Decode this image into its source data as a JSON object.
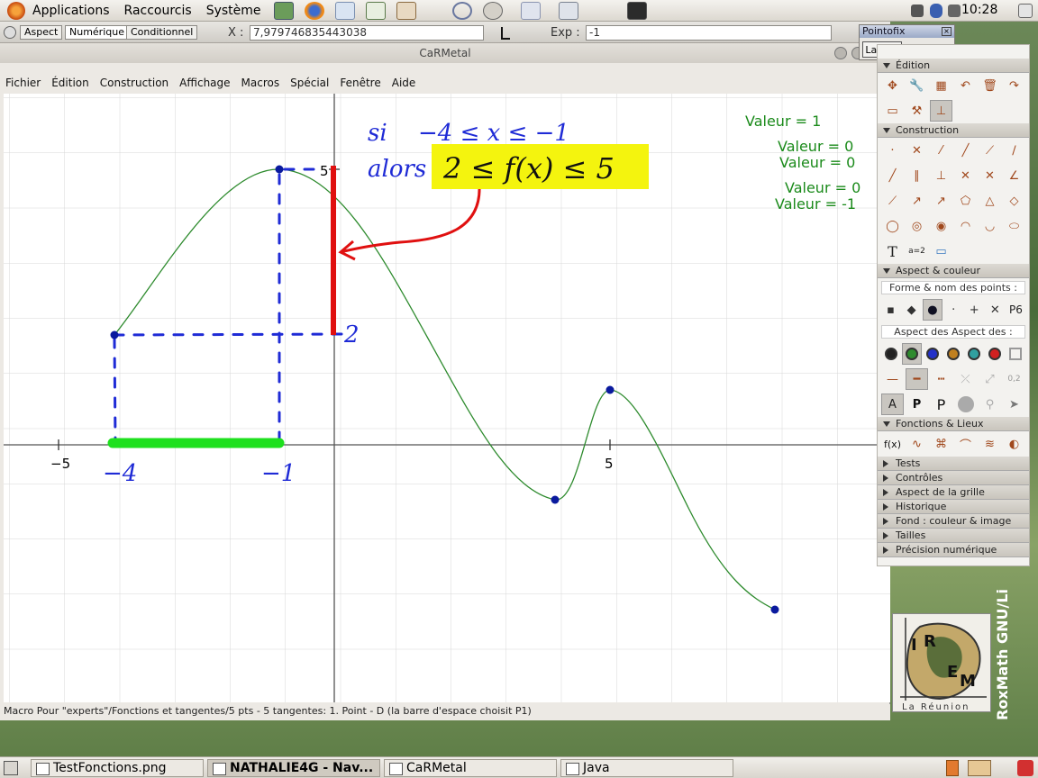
{
  "top_panel": {
    "menus": [
      "Applications",
      "Raccourcis",
      "Système"
    ],
    "clock": "10:28"
  },
  "numeric_bar": {
    "tabs": [
      "Aspect",
      "Numérique",
      "Conditionnel"
    ],
    "x_label": "X :",
    "x_value": "7,979746835443038",
    "exp_label": "Exp :",
    "exp_value": "-1"
  },
  "pointofix": {
    "title": "Pointofix",
    "button": "Lancer",
    "behind_text": "chier"
  },
  "window": {
    "title": "CaRMetal"
  },
  "menu_bar": [
    "Fichier",
    "Édition",
    "Construction",
    "Affichage",
    "Macros",
    "Spécial",
    "Fenêtre",
    "Aide"
  ],
  "canvas": {
    "valeur_labels": [
      "Valeur = 1",
      "Valeur = 0",
      "Valeur = 0",
      "Valeur = 0",
      "Valeur = -1"
    ],
    "axis_labels": {
      "x_neg5": "−5",
      "x_5": "5",
      "y_5": "5"
    },
    "annotations": {
      "si": "si",
      "si_condition": "−4 ≤ x ≤ −1",
      "alors": "alors",
      "alors_condition": "2 ≤ f(x) ≤ 5",
      "label_minus4": "−4",
      "label_minus1": "−1",
      "label_2": "2"
    },
    "colors": {
      "curve": "#2e8b2e",
      "point": "#0a1a9e",
      "annotation_blue": "#1f2bd6",
      "annotation_red": "#e01010",
      "annotation_green": "#1ee01e",
      "highlight": "#f4f40e",
      "valeur_text": "#1a8a1a"
    }
  },
  "status_bar": {
    "text": "Macro Pour \"experts\"/Fonctions et tangentes/5 pts - 5 tangentes: 1. Point - D  (la barre d'espace choisit P1)"
  },
  "palette": {
    "sections": [
      "Édition",
      "Construction",
      "Aspect & couleur",
      "Fonctions & Lieux"
    ],
    "point_shape_label": "Forme & nom des points :",
    "point_name": "P6",
    "aspect_label": "Aspect des  Aspect des  :",
    "collapsed": [
      "Tests",
      "Contrôles",
      "Aspect de la grille",
      "Historique",
      "Fond : couleur & image",
      "Tailles",
      "Précision numérique"
    ],
    "fx_label": "f(x)",
    "text_tool": "T",
    "ratio_label": "0,2"
  },
  "logo": {
    "text": "IREM",
    "subtitle": "La Réunion"
  },
  "roxmath": "RoxMath GNU/Li",
  "taskbar": [
    {
      "label": "TestFonctions.png",
      "active": false
    },
    {
      "label": "NATHALIE4G - Nav...",
      "active": true
    },
    {
      "label": "CaRMetal",
      "active": false
    },
    {
      "label": "Java",
      "active": false
    }
  ]
}
